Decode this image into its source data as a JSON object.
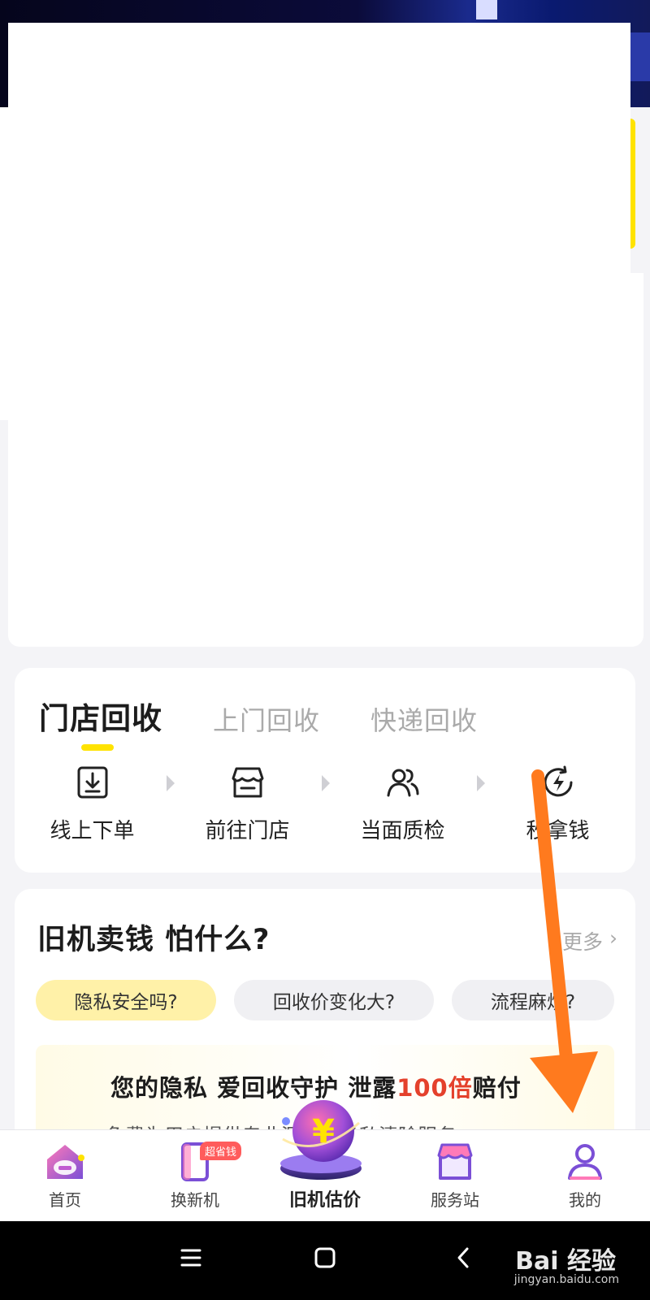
{
  "recycle": {
    "tabs": [
      "门店回收",
      "上门回收",
      "快递回收"
    ],
    "steps": [
      {
        "label": "线上下单",
        "icon": "download-icon"
      },
      {
        "label": "前往门店",
        "icon": "store-icon"
      },
      {
        "label": "当面质检",
        "icon": "people-icon"
      },
      {
        "label": "秒拿钱",
        "icon": "lightning-icon"
      }
    ]
  },
  "faq": {
    "title": "旧机卖钱 怕什么?",
    "more": "更多",
    "chips": [
      "隐私安全吗?",
      "回收价变化大?",
      "流程麻烦?"
    ],
    "promo_title_prefix": "您的隐私 爱回收守护 泄露",
    "promo_title_highlight": "100倍",
    "promo_title_suffix": "赔付",
    "promo_sub": "免费为用户提供专业深度的隐私清除服务"
  },
  "bottom_nav": {
    "items": [
      {
        "label": "首页",
        "icon": "home-icon"
      },
      {
        "label": "换新机",
        "icon": "phone-icon",
        "badge": "超省钱"
      },
      {
        "label": "旧机估价",
        "icon": "yuan-coin-icon"
      },
      {
        "label": "服务站",
        "icon": "store-icon"
      },
      {
        "label": "我的",
        "icon": "user-icon"
      }
    ]
  },
  "watermark": {
    "brand": "Bai 经验",
    "domain": "jingyan.baidu.com"
  },
  "colors": {
    "accent_yellow": "#ffe300",
    "highlight_red": "#e4412c",
    "nav_purple": "#7b4fd6",
    "annotation_orange": "#ff7a1e"
  }
}
